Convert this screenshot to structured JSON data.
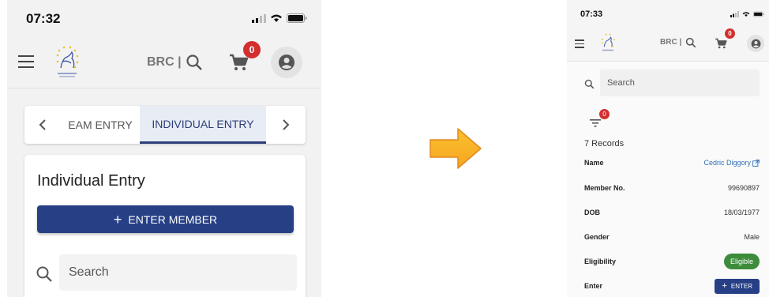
{
  "left_screen": {
    "status_bar": {
      "time": "07:32"
    },
    "app_bar": {
      "brc_label": "BRC |",
      "cart_count": "0"
    },
    "tabs": [
      {
        "label": "EAM ENTRY",
        "active": false
      },
      {
        "label": "INDIVIDUAL ENTRY",
        "active": true
      }
    ],
    "card": {
      "title": "Individual Entry",
      "enter_member_label": "ENTER MEMBER",
      "search_placeholder": "Search"
    }
  },
  "right_screen": {
    "status_bar": {
      "time": "07:33"
    },
    "app_bar": {
      "brc_label": "BRC |",
      "cart_count": "0"
    },
    "search_placeholder": "Search",
    "filter_count": "0",
    "records_label": "7 Records",
    "rows": [
      {
        "label": "Name",
        "value": "Cedric Diggory"
      },
      {
        "label": "Member No.",
        "value": "99690897"
      },
      {
        "label": "DOB",
        "value": "18/03/1977"
      },
      {
        "label": "Gender",
        "value": "Male"
      },
      {
        "label": "Eligibility",
        "value": "Eligible"
      },
      {
        "label": "Enter",
        "value": "ENTER"
      }
    ]
  },
  "colors": {
    "primary": "#263f85",
    "badge": "#d32f2f",
    "eligible": "#3c8c3c",
    "link": "#2f6fb5",
    "arrow": "#f5a623"
  },
  "icons": [
    "menu-icon",
    "search-icon",
    "cart-icon",
    "account-icon",
    "chevron-left-icon",
    "chevron-right-icon",
    "plus-icon",
    "filter-icon",
    "external-link-icon",
    "arrow-right-icon",
    "logo-icon"
  ]
}
